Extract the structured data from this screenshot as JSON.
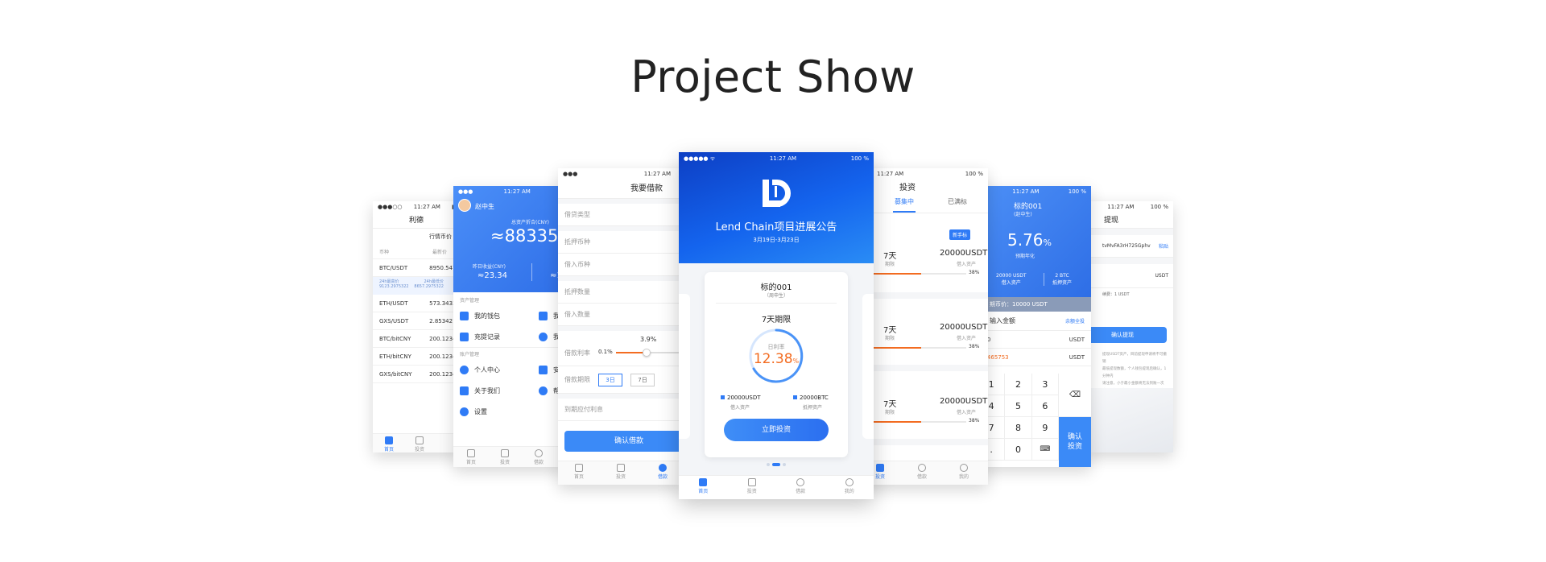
{
  "title": "Project Show",
  "colors": {
    "accent": "#2f7bf6",
    "orange": "#f36c21",
    "banner": "#1361e6"
  },
  "status": {
    "time": "11:27 AM",
    "battery": "100 %"
  },
  "p1": {
    "nav_title": "利德",
    "section": "行情币价",
    "col_coin": "币种",
    "col_price": "最新价",
    "rows": [
      {
        "pair": "BTC/USDT",
        "price": "8950.5478"
      },
      {
        "pair": "ETH/USDT",
        "price": "573.34334"
      },
      {
        "pair": "GXS/USDT",
        "price": "2.8534212"
      },
      {
        "pair": "BTC/bitCNY",
        "price": "200.12342"
      },
      {
        "pair": "ETH/bitCNY",
        "price": "200.12342"
      },
      {
        "pair": "GXS/bitCNY",
        "price": "200.12342"
      }
    ],
    "hl_label_high": "24h最高价",
    "hl_label_low": "24h最低价",
    "hl_high": "9123.2975322",
    "hl_low": "8657.2975322",
    "tab_home": "首页",
    "tab_invest": "投资"
  },
  "p2": {
    "user_name": "赵中生",
    "asset_label": "总资产折合(CNY)",
    "asset_value": "≈88335.2",
    "yday_label": "昨日收益(CNY)",
    "yday_value": "≈23.34",
    "right_value": "≈14",
    "group1": "资产管理",
    "menu1": [
      {
        "label": "我的钱包",
        "extra": "我"
      },
      {
        "label": "充提记录",
        "extra": "我"
      }
    ],
    "group2": "账户管理",
    "menu2": [
      {
        "label": "个人中心",
        "extra": "安"
      },
      {
        "label": "关于我们",
        "extra": "帮"
      },
      {
        "label": "设置",
        "extra": ""
      }
    ],
    "tab_home": "首页",
    "tab_invest": "投资",
    "tab_borrow": "借款"
  },
  "p3": {
    "nav_title": "我要借款",
    "fields": [
      "借贷类型",
      "抵押币种",
      "借入币种",
      "抵押数量",
      "借入数量"
    ],
    "rate_label": "借款利率",
    "rate_min": "0.1%",
    "rate_value": "3.9%",
    "term_label": "借款期限",
    "terms": [
      "3日",
      "7日"
    ],
    "interest_label": "到期应付利息",
    "confirm": "确认借款",
    "tab_home": "首页",
    "tab_invest": "投资",
    "tab_borrow": "借款"
  },
  "p4": {
    "banner_title": "Lend Chain项目进展公告",
    "banner_date": "3月19日-3月23日",
    "card_title": "标的001",
    "card_sub": "（周申生）",
    "period": "7天期限",
    "rate_label": "日利率",
    "rate_value": "12.38",
    "rate_unit": "%",
    "borrow_amount": "20000USDT",
    "borrow_label": "借入资产",
    "collateral_amount": "20000BTC",
    "collateral_label": "抵押资产",
    "invest_button": "立即投资",
    "tab_home": "首页",
    "tab_invest": "投资",
    "tab_borrow": "借款",
    "tab_mine": "我的"
  },
  "p5": {
    "nav_title": "投资",
    "tab_raising": "募集中",
    "tab_full": "已满标",
    "new_badge": "新手标",
    "items": [
      {
        "owner": "生)",
        "days": "7天",
        "days_label": "期限",
        "amount": "20000USDT",
        "amount_label": "借入资产",
        "progress": "38%"
      },
      {
        "owner": "生)",
        "days": "7天",
        "days_label": "期限",
        "amount": "20000USDT",
        "amount_label": "借入资产",
        "progress": "38%"
      },
      {
        "owner": "生)",
        "days": "7天",
        "days_label": "期限",
        "amount": "20000USDT",
        "amount_label": "借入资产",
        "progress": "38%"
      },
      {
        "owner": "生)"
      }
    ],
    "tab_invest": "投资",
    "tab_borrow": "借款",
    "tab_mine": "我的"
  },
  "p6": {
    "item_title": "标的001",
    "item_sub": "(赵中生)",
    "rate": "5.76",
    "rate_unit": "%",
    "rate_label": "预期年化",
    "borrow_amount": "20000 USDT",
    "borrow_label": "借入资产",
    "collateral_amount": "2 BTC",
    "collateral_label": "抵押资产",
    "min_label": "期币价：10000 USDT",
    "input_label": "输入金额",
    "all_invest": "余额全投",
    "val1": "000",
    "unit1": "USDT",
    "val2": "10465753",
    "unit2": "USDT",
    "keys": [
      "1",
      "2",
      "3",
      "4",
      "5",
      "6",
      "7",
      "8",
      "9",
      ".",
      "0",
      "⌨"
    ],
    "confirm_line1": "确认",
    "confirm_line2": "投资"
  },
  "p7": {
    "nav_title": "提现",
    "address": "tvMvFA3rH725Gphv",
    "paste": "粘贴",
    "unit": "USDT",
    "fee": "续费：1 USDT",
    "confirm": "确认提现",
    "note1": "提现USDT资产，目前提现申请将不可撤销",
    "note2": "最低提现数额，个人钱包提现后确认，1分钟内",
    "note3": "请注意，小于最小金额将无法到账一次",
    "note4": "请您自行核对提现地址，信息有误导致资金无法到账"
  }
}
